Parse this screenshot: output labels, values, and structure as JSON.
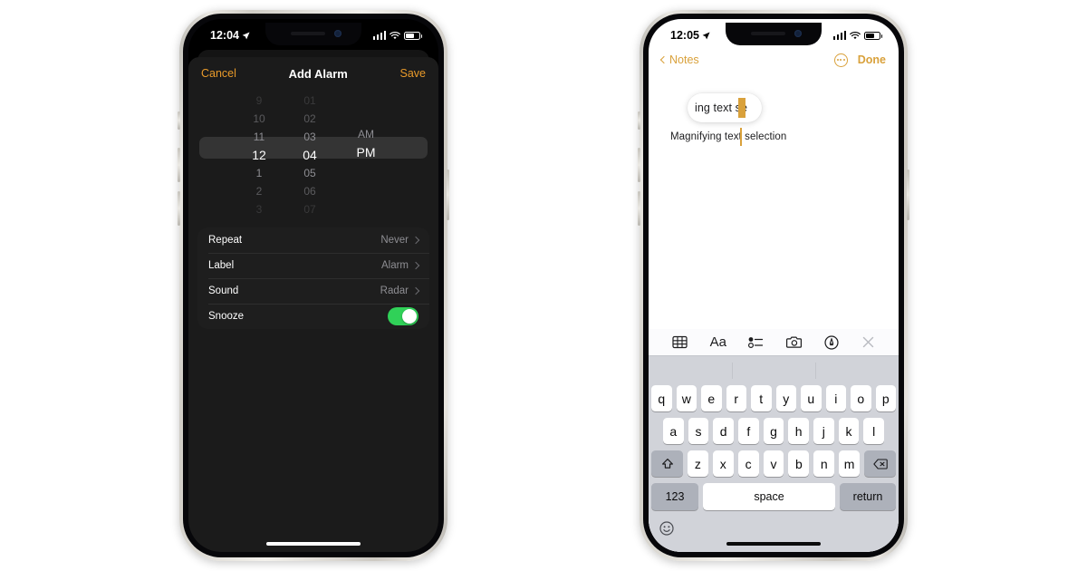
{
  "phones": {
    "left": {
      "status": {
        "time": "12:04",
        "location_icon": "location-arrow-icon",
        "signal_icon": "cellular-signal-icon",
        "wifi_icon": "wifi-icon",
        "battery_icon": "battery-icon"
      },
      "navbar": {
        "cancel": "Cancel",
        "title": "Add Alarm",
        "save": "Save"
      },
      "picker": {
        "hours": [
          "9",
          "10",
          "11",
          "12",
          "1",
          "2",
          "3"
        ],
        "minutes": [
          "01",
          "02",
          "03",
          "04",
          "05",
          "06",
          "07"
        ],
        "periods": [
          "",
          "",
          "AM",
          "PM",
          "",
          "",
          ""
        ],
        "selected_hour": "12",
        "selected_minute": "04",
        "selected_period": "PM"
      },
      "rows": [
        {
          "label": "Repeat",
          "value": "Never",
          "type": "disclosure"
        },
        {
          "label": "Label",
          "value": "Alarm",
          "type": "disclosure"
        },
        {
          "label": "Sound",
          "value": "Radar",
          "type": "disclosure"
        },
        {
          "label": "Snooze",
          "value": "on",
          "type": "toggle"
        }
      ],
      "accent": "#e89a2a",
      "toggle_on_color": "#30d158"
    },
    "right": {
      "status": {
        "time": "12:05",
        "location_icon": "location-arrow-icon",
        "signal_icon": "cellular-signal-icon",
        "wifi_icon": "wifi-icon",
        "battery_icon": "battery-icon"
      },
      "navbar": {
        "back": "Notes",
        "more_icon": "more-circle-icon",
        "done": "Done"
      },
      "note": {
        "text": "Magnifying text selection",
        "loupe_text": "ing text se"
      },
      "toolbar": [
        {
          "icon": "table-icon",
          "label": ""
        },
        {
          "icon": "text-format-icon",
          "label": "Aa"
        },
        {
          "icon": "checklist-icon",
          "label": ""
        },
        {
          "icon": "camera-icon",
          "label": ""
        },
        {
          "icon": "markup-pen-icon",
          "label": ""
        },
        {
          "icon": "close-icon",
          "label": ""
        }
      ],
      "keyboard": {
        "row1": [
          "q",
          "w",
          "e",
          "r",
          "t",
          "y",
          "u",
          "i",
          "o",
          "p"
        ],
        "row2": [
          "a",
          "s",
          "d",
          "f",
          "g",
          "h",
          "j",
          "k",
          "l"
        ],
        "row3": [
          "z",
          "x",
          "c",
          "v",
          "b",
          "n",
          "m"
        ],
        "shift_icon": "shift-icon",
        "backspace_icon": "backspace-icon",
        "numbers": "123",
        "space": "space",
        "return": "return",
        "emoji_icon": "emoji-icon"
      },
      "accent": "#d9a13b"
    }
  }
}
